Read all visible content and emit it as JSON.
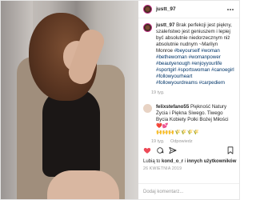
{
  "post": {
    "username": "justt_97",
    "caption": "Brak perfekcji jest piękny, szaleństwo jest geniuszem i lepiej być absolutnie niedorzecznym niż absolutnie nudnym ~Marilyn Monroe",
    "hashtags": "#beyourself #woman #bethewoman #womanpower #beautyenough #enjoyyourlife #sportgirl #sportswoman #canoegirl #followyourheart #followyourdreams #carpediem",
    "caption_time": "19 tyg.",
    "likes_prefix": "Lubią to ",
    "likes_user": "kond_o_r",
    "likes_middle": " i ",
    "likes_others": "innych użytkowników",
    "date": "26 KWIETNIA 2019",
    "add_comment_placeholder": "Dodaj komentarz..."
  },
  "comment": {
    "username": "felixstefano55",
    "text": "Piękność Natury Życia i Piękna Siwego. Tiwego Bycia Kobiety Polki Bożej Miłości ❤️💕",
    "emoji_line": "🙌🙌🙌🌾🌾🌾🌾",
    "time": "19 tyg.",
    "reply": "Odpowiedz"
  },
  "icons": {
    "heart": "heart-icon",
    "comment": "comment-icon",
    "share": "share-icon",
    "bookmark": "bookmark-icon",
    "more": "more-icon"
  },
  "colors": {
    "hashtag": "#003569",
    "meta": "#999999",
    "border": "#efefef"
  }
}
